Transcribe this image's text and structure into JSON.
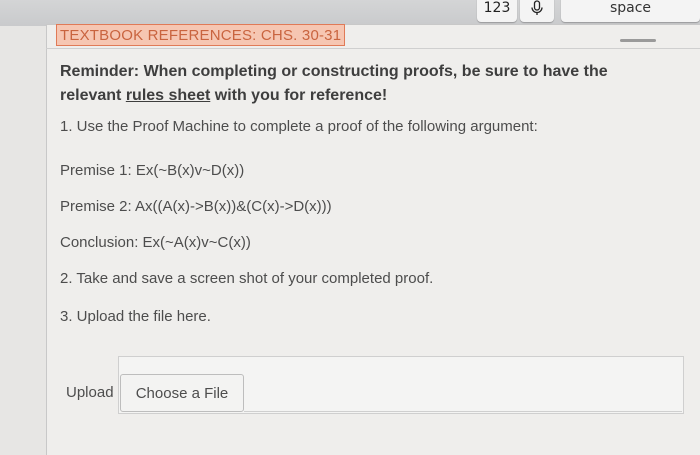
{
  "keyboard": {
    "numbers_key": "123",
    "mic_icon": "microphone-icon",
    "space_key": "space"
  },
  "heading": "TEXTBOOK REFERENCES: CHS. 30-31",
  "reminder": {
    "prefix": "Reminder: When completing or constructing proofs, be sure to have the relevant ",
    "link": "rules sheet",
    "suffix": " with you for reference!"
  },
  "instructions": {
    "step1": "1. Use the Proof Machine to complete a proof of the following argument:",
    "premise1": "Premise 1: Ex(~B(x)v~D(x))",
    "premise2": "Premise 2: Ax((A(x)->B(x))&(C(x)->D(x)))",
    "conclusion": "Conclusion: Ex(~A(x)v~C(x))",
    "step2": "2. Take and save a screen shot of your completed proof.",
    "step3": "3. Upload the file here."
  },
  "upload": {
    "label": "Upload",
    "button": "Choose a File"
  },
  "colors": {
    "heading_bg": "#f6c6b2",
    "heading_text": "#c9643f"
  }
}
